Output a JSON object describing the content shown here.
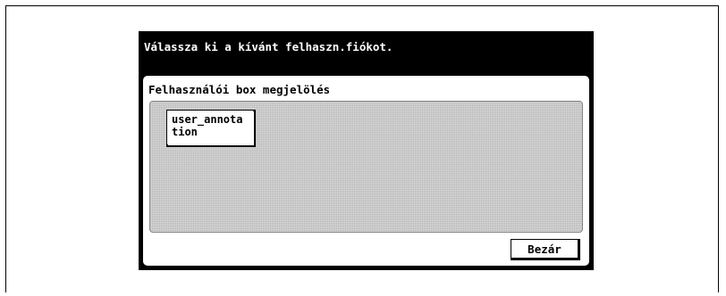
{
  "message_bar": {
    "text": "Válassza ki a kívánt felhaszn.fiókot."
  },
  "panel": {
    "title": "Felhasználói box megjelölés",
    "boxes": [
      {
        "label": "user_annotation"
      }
    ],
    "close_label": "Bezár"
  },
  "colors": {
    "message_bar_bg": "#000000",
    "message_bar_text": "#ffffff",
    "box_area_pattern": "#c8c8c8",
    "button_bg": "#ffffff"
  }
}
